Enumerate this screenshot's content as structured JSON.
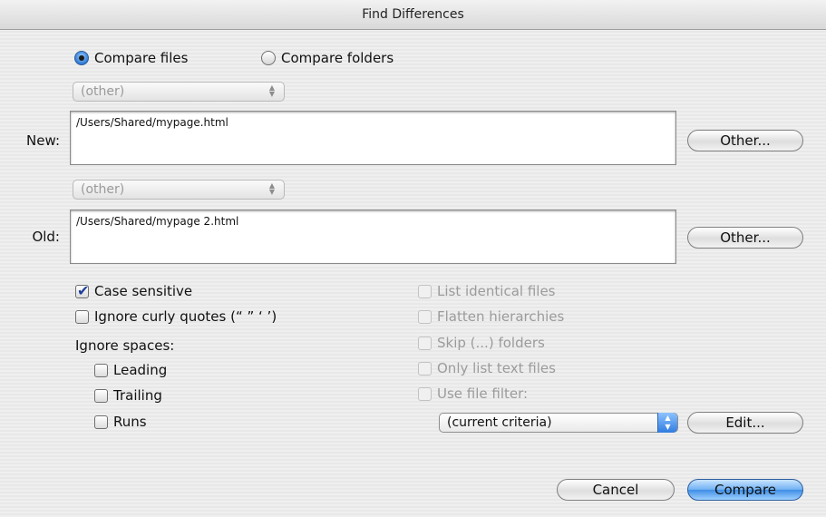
{
  "window": {
    "title": "Find Differences"
  },
  "mode": {
    "compare_files": "Compare files",
    "compare_folders": "Compare folders"
  },
  "new_section": {
    "popup_value": "(other)",
    "label": "New:",
    "path": "/Users/Shared/mypage.html",
    "other_button": "Other..."
  },
  "old_section": {
    "popup_value": "(other)",
    "label": "Old:",
    "path": "/Users/Shared/mypage 2.html",
    "other_button": "Other..."
  },
  "options": {
    "case_sensitive": "Case sensitive",
    "ignore_curly_quotes": "Ignore curly quotes (“ ” ‘ ’)",
    "ignore_spaces": "Ignore spaces:",
    "leading": "Leading",
    "trailing": "Trailing",
    "runs": "Runs"
  },
  "folder_options": {
    "list_identical": "List identical files",
    "flatten": "Flatten hierarchies",
    "skip_folders": "Skip (...) folders",
    "only_text": "Only list text files",
    "use_filter": "Use file filter:"
  },
  "filter": {
    "popup_value": "(current criteria)",
    "edit_button": "Edit..."
  },
  "footer": {
    "cancel_button": "Cancel",
    "compare_button": "Compare"
  },
  "colors": {
    "accent": "#3f8ee6"
  }
}
